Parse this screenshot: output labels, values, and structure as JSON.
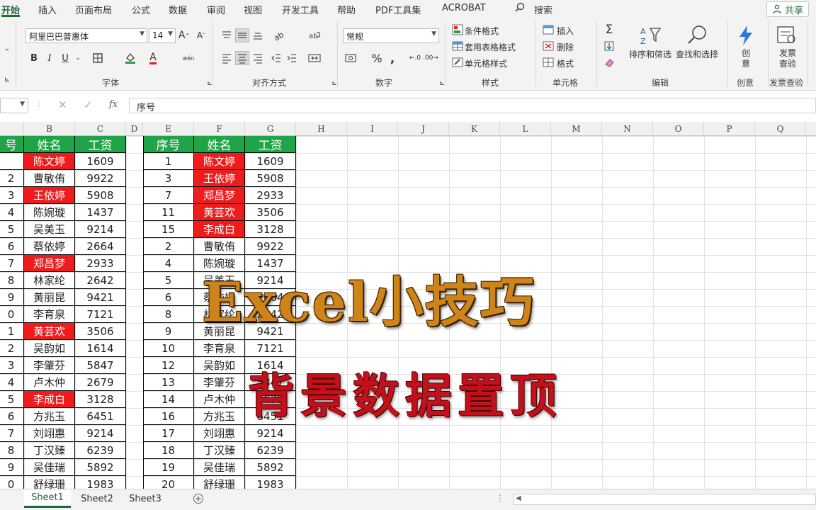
{
  "menu": {
    "tabs": [
      "开始",
      "插入",
      "页面布局",
      "公式",
      "数据",
      "审阅",
      "视图",
      "开发工具",
      "帮助",
      "PDF工具集",
      "ACROBAT"
    ],
    "search_label": "搜索",
    "share_label": "共享"
  },
  "ribbon": {
    "font_name": "阿里巴巴普惠体",
    "font_size": "14",
    "number_format": "常规",
    "bold": "B",
    "italic": "I",
    "underline": "U",
    "groups": {
      "font": "字体",
      "alignment": "对齐方式",
      "number": "数字",
      "styles": "样式",
      "cells": "单元格",
      "editing": "编辑",
      "creative": "创意",
      "invoice": "发票查验"
    },
    "styles_items": [
      "条件格式",
      "套用表格格式",
      "单元格样式"
    ],
    "cells_items": [
      "插入",
      "删除",
      "格式"
    ],
    "editing_items": [
      "排序和筛选",
      "查找和选择"
    ],
    "creative_label": "创意",
    "invoice_label": "发票查验"
  },
  "formula_bar": {
    "fx": "fx",
    "content": "序号"
  },
  "columns": [
    "B",
    "C",
    "D",
    "E",
    "F",
    "G",
    "H",
    "I",
    "J",
    "K",
    "L",
    "M",
    "N",
    "O",
    "P",
    "Q"
  ],
  "left_table": {
    "headers": [
      "号",
      "姓名",
      "工资"
    ],
    "rows": [
      {
        "a": "",
        "name": "陈文婷",
        "pay": "1609",
        "hl": true
      },
      {
        "a": "2",
        "name": "曹敏侑",
        "pay": "9922",
        "hl": false
      },
      {
        "a": "3",
        "name": "王依婷",
        "pay": "5908",
        "hl": true
      },
      {
        "a": "4",
        "name": "陈婉璇",
        "pay": "1437",
        "hl": false
      },
      {
        "a": "5",
        "name": "吴美玉",
        "pay": "9214",
        "hl": false
      },
      {
        "a": "6",
        "name": "蔡依婷",
        "pay": "2664",
        "hl": false
      },
      {
        "a": "7",
        "name": "郑昌梦",
        "pay": "2933",
        "hl": true
      },
      {
        "a": "8",
        "name": "林家纶",
        "pay": "2642",
        "hl": false
      },
      {
        "a": "9",
        "name": "黄丽昆",
        "pay": "9421",
        "hl": false
      },
      {
        "a": "0",
        "name": "李育泉",
        "pay": "7121",
        "hl": false
      },
      {
        "a": "1",
        "name": "黄芸欢",
        "pay": "3506",
        "hl": true
      },
      {
        "a": "2",
        "name": "吴韵如",
        "pay": "1614",
        "hl": false
      },
      {
        "a": "3",
        "name": "李肇芬",
        "pay": "5847",
        "hl": false
      },
      {
        "a": "4",
        "name": "卢木仲",
        "pay": "2679",
        "hl": false
      },
      {
        "a": "5",
        "name": "李成白",
        "pay": "3128",
        "hl": true
      },
      {
        "a": "6",
        "name": "方兆玉",
        "pay": "6451",
        "hl": false
      },
      {
        "a": "7",
        "name": "刘翊惠",
        "pay": "9214",
        "hl": false
      },
      {
        "a": "8",
        "name": "丁汉臻",
        "pay": "6239",
        "hl": false
      },
      {
        "a": "9",
        "name": "吴佳瑞",
        "pay": "5892",
        "hl": false
      },
      {
        "a": "0",
        "name": "舒绿珊",
        "pay": "1983",
        "hl": false
      }
    ]
  },
  "right_table": {
    "headers": [
      "序号",
      "姓名",
      "工资"
    ],
    "rows": [
      {
        "no": "1",
        "name": "陈文婷",
        "pay": "1609",
        "hl": true
      },
      {
        "no": "3",
        "name": "王依婷",
        "pay": "5908",
        "hl": true
      },
      {
        "no": "7",
        "name": "郑昌梦",
        "pay": "2933",
        "hl": true
      },
      {
        "no": "11",
        "name": "黄芸欢",
        "pay": "3506",
        "hl": true
      },
      {
        "no": "15",
        "name": "李成白",
        "pay": "3128",
        "hl": true
      },
      {
        "no": "2",
        "name": "曹敏侑",
        "pay": "9922",
        "hl": false
      },
      {
        "no": "4",
        "name": "陈婉璇",
        "pay": "1437",
        "hl": false
      },
      {
        "no": "5",
        "name": "吴美玉",
        "pay": "9214",
        "hl": false
      },
      {
        "no": "6",
        "name": "蔡依婷",
        "pay": "2664",
        "hl": false
      },
      {
        "no": "8",
        "name": "林家纶",
        "pay": "2642",
        "hl": false
      },
      {
        "no": "9",
        "name": "黄丽昆",
        "pay": "9421",
        "hl": false
      },
      {
        "no": "10",
        "name": "李育泉",
        "pay": "7121",
        "hl": false
      },
      {
        "no": "12",
        "name": "吴韵如",
        "pay": "1614",
        "hl": false
      },
      {
        "no": "13",
        "name": "李肇芬",
        "pay": "5847",
        "hl": false
      },
      {
        "no": "14",
        "name": "卢木仲",
        "pay": "2679",
        "hl": false
      },
      {
        "no": "16",
        "name": "方兆玉",
        "pay": "6451",
        "hl": false
      },
      {
        "no": "17",
        "name": "刘翊惠",
        "pay": "9214",
        "hl": false
      },
      {
        "no": "18",
        "name": "丁汉臻",
        "pay": "6239",
        "hl": false
      },
      {
        "no": "19",
        "name": "吴佳瑞",
        "pay": "5892",
        "hl": false
      },
      {
        "no": "20",
        "name": "舒绿珊",
        "pay": "1983",
        "hl": false
      }
    ]
  },
  "overlay": {
    "title": "Excel小技巧",
    "subtitle": "背景数据置顶"
  },
  "sheet_tabs": [
    "Sheet1",
    "Sheet2",
    "Sheet3"
  ],
  "colors": {
    "header_green": "#21a347",
    "highlight_red": "#ee1c1c",
    "excel_green": "#1e6b3a",
    "title_orange": "#cf8419",
    "subtitle_red": "#c4101a"
  }
}
